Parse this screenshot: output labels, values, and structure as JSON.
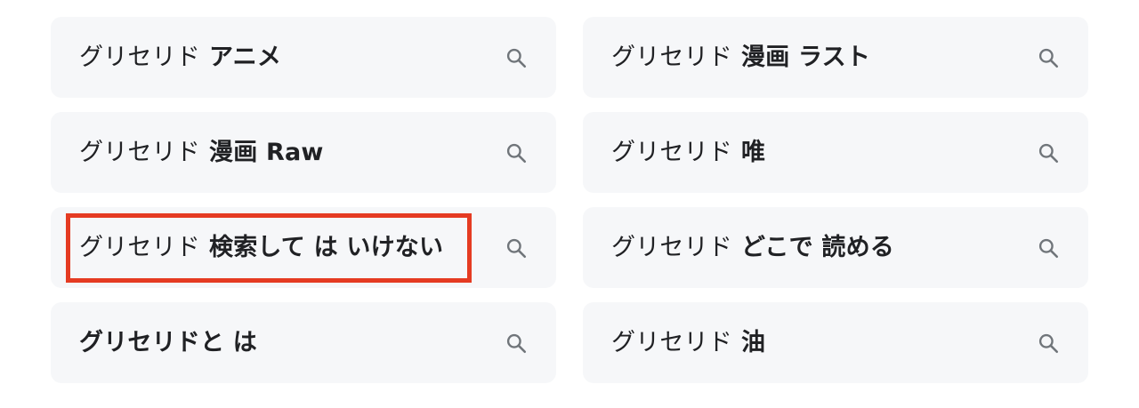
{
  "related_searches": {
    "items": [
      {
        "base": "グリセリド",
        "bold": "アニメ"
      },
      {
        "base": "グリセリド",
        "bold": "漫画 ラスト"
      },
      {
        "base": "グリセリド",
        "bold": "漫画 Raw"
      },
      {
        "base": "グリセリド",
        "bold": "唯"
      },
      {
        "base": "グリセリド",
        "bold": "検索して は いけない"
      },
      {
        "base": "グリセリド",
        "bold": "どこで 読める"
      },
      {
        "base": "",
        "bold": "グリセリドと は"
      },
      {
        "base": "グリセリド",
        "bold": "油"
      }
    ],
    "icon": "search-icon",
    "highlighted_index": 4
  },
  "colors": {
    "chip_background": "#f6f7f9",
    "text": "#202124",
    "icon": "#70757a",
    "highlight_border": "#e53b22"
  }
}
